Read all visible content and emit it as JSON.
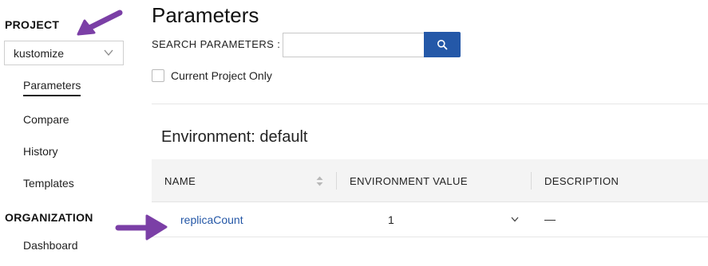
{
  "sidebar": {
    "project_heading": "PROJECT",
    "project_select": {
      "value": "kustomize",
      "icon": "chevron-down-icon"
    },
    "nav_items": [
      {
        "label": "Parameters",
        "active": true
      },
      {
        "label": "Compare"
      },
      {
        "label": "History"
      },
      {
        "label": "Templates"
      }
    ],
    "organization_heading": "ORGANIZATION",
    "organization_items": [
      {
        "label": "Dashboard"
      }
    ]
  },
  "main": {
    "title": "Parameters",
    "search": {
      "label": "SEARCH PARAMETERS :",
      "value": "",
      "placeholder": "",
      "button_icon": "search-icon"
    },
    "filter": {
      "label": "Current Project Only",
      "checked": false
    },
    "environment_heading": "Environment: default",
    "table": {
      "columns": [
        "NAME",
        "ENVIRONMENT VALUE",
        "DESCRIPTION"
      ],
      "rows": [
        {
          "name": "replicaCount",
          "value": "1",
          "description": "—"
        }
      ]
    }
  },
  "colors": {
    "accent": "#2458a8",
    "link": "#2356a6",
    "annotation_arrow": "#7b3fa6",
    "header_bg": "#f4f4f4"
  }
}
